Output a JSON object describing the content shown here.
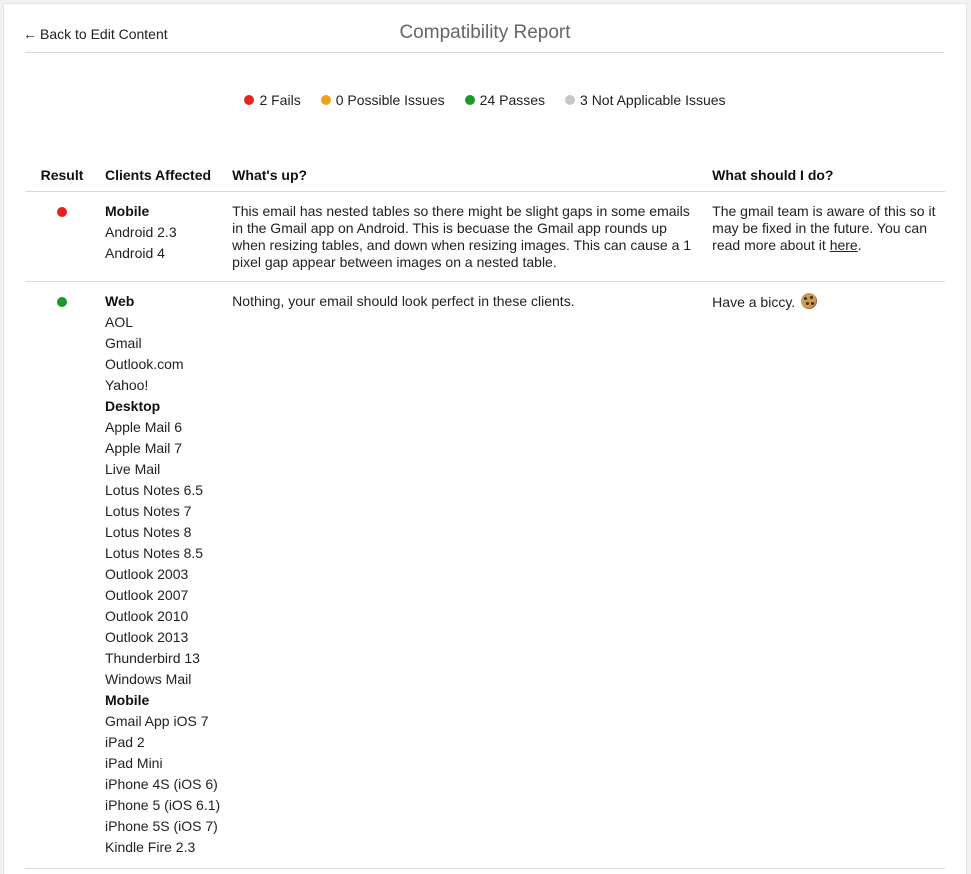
{
  "header": {
    "back_label": "Back to Edit Content",
    "back_arrow": "←",
    "title": "Compatibility Report"
  },
  "summary": [
    {
      "label": "2 Fails",
      "color": "#e8211f"
    },
    {
      "label": "0 Possible Issues",
      "color": "#f0a215"
    },
    {
      "label": "24 Passes",
      "color": "#1a9a2a"
    },
    {
      "label": "3 Not Applicable Issues",
      "color": "#c8c8c8"
    }
  ],
  "table": {
    "columns": [
      "Result",
      "Clients Affected",
      "What's up?",
      "What should I do?"
    ],
    "rows": [
      {
        "result_color": "#e8211f",
        "clients": [
          {
            "text": "Mobile",
            "group": true
          },
          {
            "text": "Android 2.3"
          },
          {
            "text": "Android 4"
          }
        ],
        "whats_up": "This email has nested tables so there might be slight gaps in some emails in the Gmail app on Android. This is becuase the Gmail app rounds up when resizing tables, and down when resizing images. This can cause a 1 pixel gap appear between images on a nested table.",
        "what_to_do": "The gmail team is aware of this so it may be fixed in the future. You can read more about it ",
        "what_to_do_link": "here",
        "what_to_do_end": "."
      },
      {
        "result_color": "#1a9a2a",
        "clients": [
          {
            "text": "Web",
            "group": true
          },
          {
            "text": "AOL"
          },
          {
            "text": "Gmail"
          },
          {
            "text": "Outlook.com"
          },
          {
            "text": "Yahoo!"
          },
          {
            "text": "Desktop",
            "group": true
          },
          {
            "text": "Apple Mail 6"
          },
          {
            "text": "Apple Mail 7"
          },
          {
            "text": "Live Mail"
          },
          {
            "text": "Lotus Notes 6.5"
          },
          {
            "text": "Lotus Notes 7"
          },
          {
            "text": "Lotus Notes 8"
          },
          {
            "text": "Lotus Notes 8.5"
          },
          {
            "text": "Outlook 2003"
          },
          {
            "text": "Outlook 2007"
          },
          {
            "text": "Outlook 2010"
          },
          {
            "text": "Outlook 2013"
          },
          {
            "text": "Thunderbird 13"
          },
          {
            "text": "Windows Mail"
          },
          {
            "text": "Mobile",
            "group": true
          },
          {
            "text": "Gmail App iOS 7"
          },
          {
            "text": "iPad 2"
          },
          {
            "text": "iPad Mini"
          },
          {
            "text": "iPhone 4S (iOS 6)"
          },
          {
            "text": "iPhone 5 (iOS 6.1)"
          },
          {
            "text": "iPhone 5S (iOS 7)"
          },
          {
            "text": "Kindle Fire 2.3"
          }
        ],
        "whats_up": "Nothing, your email should look perfect in these clients.",
        "what_to_do": "Have a biccy. ",
        "what_to_do_icon": "cookie-icon"
      }
    ]
  }
}
